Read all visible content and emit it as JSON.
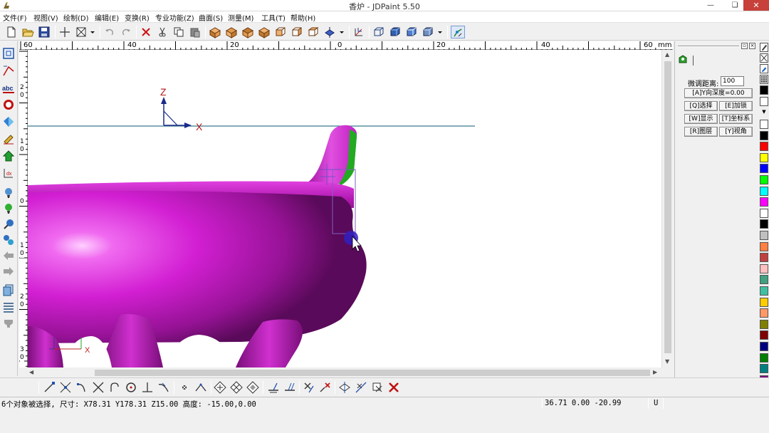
{
  "window": {
    "title": "香炉 - JDPaint 5.50",
    "app_icon": "jdpaint-app-icon",
    "controls": [
      "minimize",
      "maximize",
      "close"
    ]
  },
  "menu": [
    {
      "id": "file",
      "label": "文件(F)"
    },
    {
      "id": "view",
      "label": "视图(V)"
    },
    {
      "id": "draw",
      "label": "绘制(D)"
    },
    {
      "id": "edit",
      "label": "编辑(E)"
    },
    {
      "id": "transform",
      "label": "变换(R)"
    },
    {
      "id": "special",
      "label": "专业功能(Z)"
    },
    {
      "id": "surface",
      "label": "曲面(S)"
    },
    {
      "id": "measure",
      "label": "测量(M)"
    },
    {
      "id": "tools",
      "label": "工具(T)"
    },
    {
      "id": "help",
      "label": "帮助(H)"
    }
  ],
  "ruler_top": {
    "labels": [
      "60",
      "40",
      "20",
      "0",
      "20",
      "40",
      "60"
    ],
    "unit": "mm"
  },
  "ruler_left": {
    "labels": [
      "2\n0",
      "1\n0",
      "0",
      "1\n0",
      "2\n0",
      "3\n0"
    ]
  },
  "viewport": {
    "axis_labels": {
      "z": "Z",
      "x": "X",
      "local_x": "X"
    },
    "model_color": "#d21fd2",
    "highlight_color": "#22aa22",
    "axis_line_color": "#3a7a8c"
  },
  "right_panel": {
    "tab_icon": "layer-tab-icon",
    "fine_tune_label": "微调距离:",
    "fine_tune_value": "100",
    "buttons": [
      {
        "id": "y-depth",
        "label": "[A]Y向深度=0.00"
      },
      {
        "id": "select",
        "label": "[Q]选择"
      },
      {
        "id": "lock",
        "label": "[E]加锁"
      },
      {
        "id": "display",
        "label": "[W]显示"
      },
      {
        "id": "coord",
        "label": "[T]坐标系"
      },
      {
        "id": "layer",
        "label": "[R]图层"
      },
      {
        "id": "view-angle",
        "label": "[Y]视角"
      }
    ]
  },
  "palette": {
    "colors": [
      "#ffffff",
      "#000000",
      "#ff0000",
      "#ffff00",
      "#0000ff",
      "#00ff00",
      "#00ffff",
      "#ff00ff",
      "#ffffff",
      "#000000",
      "#c0c0c0",
      "#ff8040",
      "#c04040",
      "#ffc0c0",
      "#40a080",
      "#40c0a0",
      "#ffcc00",
      "#ff9966",
      "#808000",
      "#800000",
      "#000080",
      "#008000",
      "#008080",
      "#800080"
    ]
  },
  "status": {
    "message": "6个对象被选择, 尺寸: X78.31 Y178.31 Z15.00 高度: -15.00,0.00",
    "coords": "36.71 0.00 -20.99",
    "unit_flag": "U"
  }
}
